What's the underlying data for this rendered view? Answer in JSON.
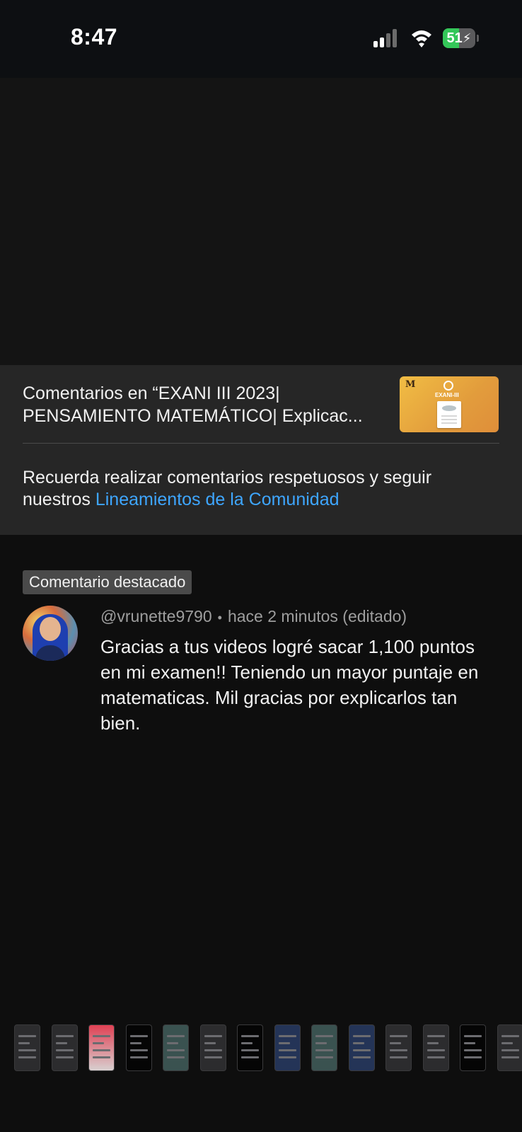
{
  "status_bar": {
    "time": "8:47",
    "battery": "51",
    "battery_level_percent": 51,
    "signal_bars_active": 2,
    "icons": [
      "signal-icon",
      "wifi-icon",
      "battery-icon",
      "charging-bolt-icon"
    ]
  },
  "header": {
    "title": "Comentarios en “EXANI III 2023| PENSAMIENTO MATEMÁTICO| Explicac...",
    "thumbnail": {
      "mark": "M",
      "label": "EXANI-III"
    },
    "guidelines_prefix": "Recuerda realizar comentarios respetuosos y seguir nuestros ",
    "guidelines_link": "Lineamientos de la Comunidad"
  },
  "comment": {
    "badge": "Comentario destacado",
    "author": "@vrunette9790",
    "separator": "•",
    "time": "hace 2 minutos (editado)",
    "text": "Gracias a tus videos logré sacar 1,100 puntos en mi examen!! Teniendo un mayor puntaje en matematicas. Mil gracias por explicarlos tan bien."
  },
  "colors": {
    "link": "#3ea6ff",
    "battery": "#34c759",
    "panel": "#262626",
    "badge": "#4a4a4a"
  },
  "app_strip": {
    "thumbnails": [
      "default",
      "default",
      "red",
      "black",
      "teal",
      "default",
      "black",
      "navy",
      "teal",
      "navy",
      "default",
      "default",
      "black",
      "default"
    ]
  }
}
